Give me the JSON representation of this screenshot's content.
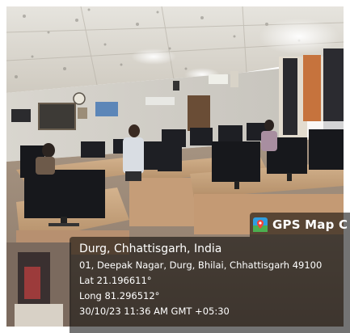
{
  "overlay": {
    "app_label": "GPS Map C",
    "location_title": "Durg, Chhattisgarh, India",
    "address": "01, Deepak Nagar, Durg, Bhilai, Chhattisgarh 49100",
    "latitude": "Lat 21.196611°",
    "longitude": "Long 81.296512°",
    "timestamp": "30/10/23 11:36 AM GMT +05:30"
  },
  "colors": {
    "overlay_bg": "#000000",
    "overlay_text": "#ffffff"
  }
}
